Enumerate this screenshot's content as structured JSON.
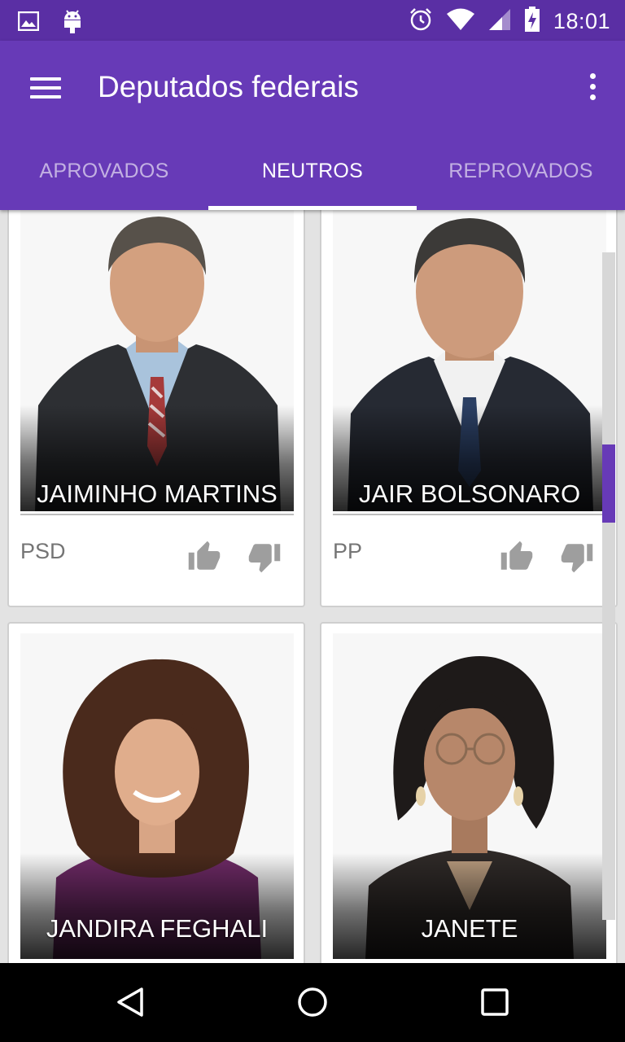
{
  "status_bar": {
    "time": "18:01",
    "icons": [
      "image-notification-icon",
      "android-notification-icon",
      "alarm-icon",
      "wifi-icon",
      "signal-icon",
      "battery-charging-icon"
    ]
  },
  "app_bar": {
    "title": "Deputados federais",
    "menu_icon": "hamburger-menu-icon",
    "overflow_icon": "more-vert-icon"
  },
  "tabs": [
    {
      "label": "APROVADOS",
      "active": false
    },
    {
      "label": "NEUTROS",
      "active": true
    },
    {
      "label": "REPROVADOS",
      "active": false
    }
  ],
  "deputies": [
    {
      "name": "JAIMINHO MARTINS",
      "party": "PSD"
    },
    {
      "name": "JAIR BOLSONARO",
      "party": "PP"
    },
    {
      "name": "JANDIRA FEGHALI",
      "party": ""
    },
    {
      "name": "JANETE",
      "party": ""
    }
  ],
  "vote_icons": {
    "up": "thumb-up-icon",
    "down": "thumb-down-icon"
  },
  "colors": {
    "status_bar": "#5a2fa4",
    "primary": "#673ab7",
    "icon_gray": "#9e9e9e",
    "background": "#e3e3e3"
  },
  "nav_bar": {
    "buttons": [
      "back-icon",
      "home-icon",
      "recents-icon"
    ]
  }
}
